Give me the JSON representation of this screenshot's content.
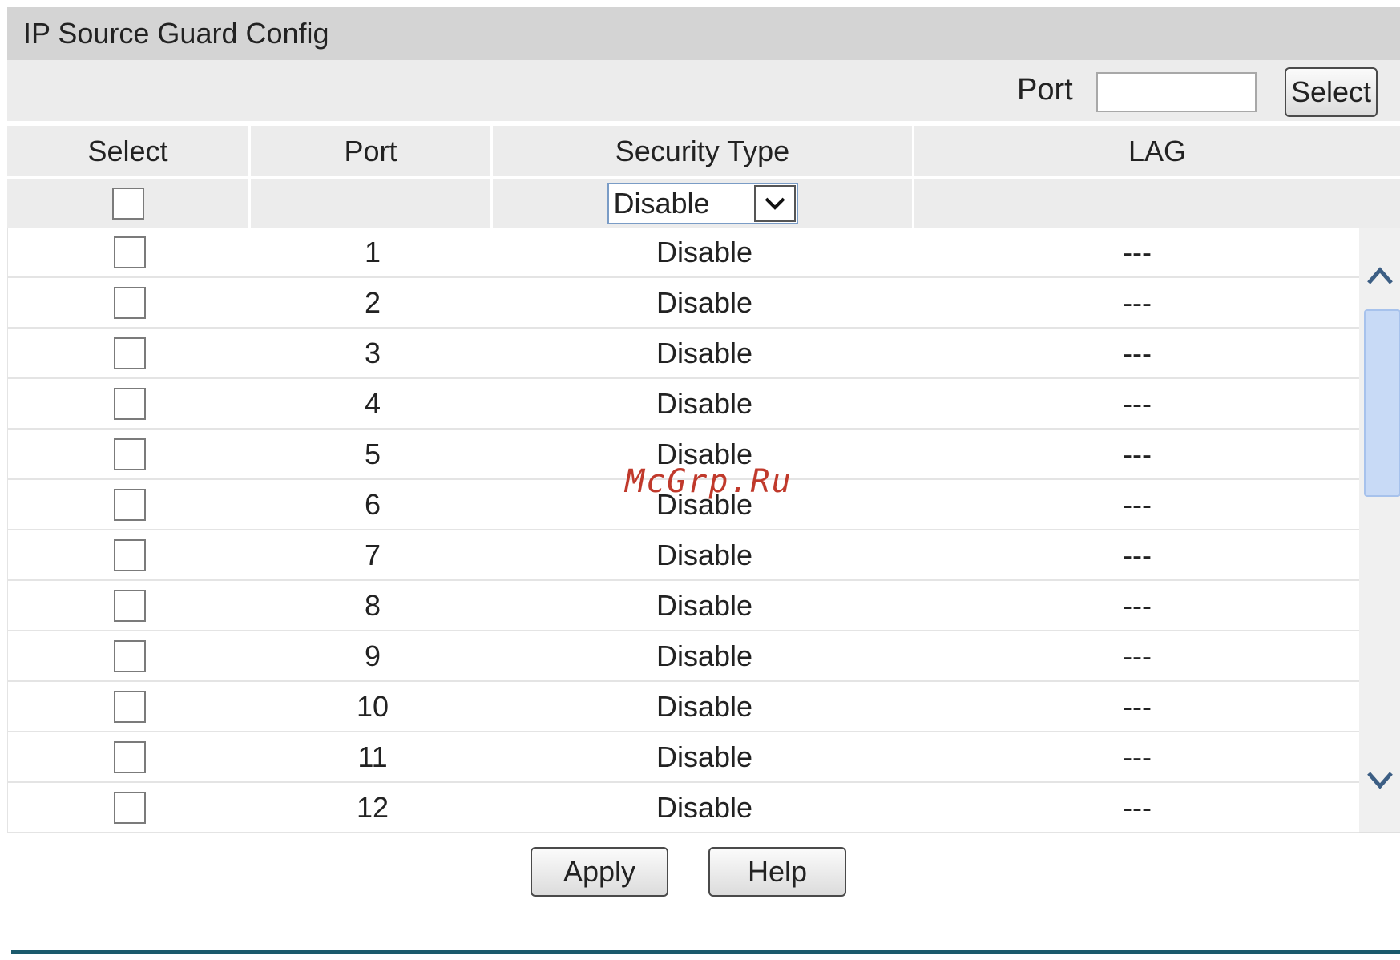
{
  "panel": {
    "title": "IP Source Guard Config"
  },
  "filter": {
    "port_label": "Port",
    "port_value": "",
    "select_button": "Select"
  },
  "columns": {
    "select": "Select",
    "port": "Port",
    "security_type": "Security Type",
    "lag": "LAG"
  },
  "edit_row": {
    "security_type_value": "Disable",
    "options": [
      "Disable"
    ]
  },
  "rows": [
    {
      "port": "1",
      "security_type": "Disable",
      "lag": "---"
    },
    {
      "port": "2",
      "security_type": "Disable",
      "lag": "---"
    },
    {
      "port": "3",
      "security_type": "Disable",
      "lag": "---"
    },
    {
      "port": "4",
      "security_type": "Disable",
      "lag": "---"
    },
    {
      "port": "5",
      "security_type": "Disable",
      "lag": "---"
    },
    {
      "port": "6",
      "security_type": "Disable",
      "lag": "---"
    },
    {
      "port": "7",
      "security_type": "Disable",
      "lag": "---"
    },
    {
      "port": "8",
      "security_type": "Disable",
      "lag": "---"
    },
    {
      "port": "9",
      "security_type": "Disable",
      "lag": "---"
    },
    {
      "port": "10",
      "security_type": "Disable",
      "lag": "---"
    },
    {
      "port": "11",
      "security_type": "Disable",
      "lag": "---"
    },
    {
      "port": "12",
      "security_type": "Disable",
      "lag": "---"
    }
  ],
  "actions": {
    "apply": "Apply",
    "help": "Help"
  },
  "watermark": "McGrp.Ru",
  "icons": {
    "dropdown": "chevron-down-icon",
    "scroll_up": "chevron-up-icon",
    "scroll_down": "chevron-down-icon"
  }
}
